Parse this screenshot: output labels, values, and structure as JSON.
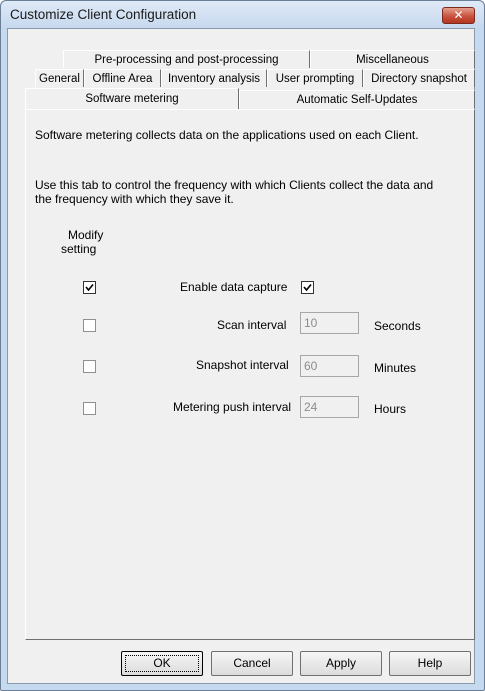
{
  "window": {
    "title": "Customize Client Configuration",
    "close_glyph": "✕"
  },
  "tabs": {
    "row1": [
      "Pre-processing and post-processing",
      "Miscellaneous"
    ],
    "row2": [
      "General",
      "Offline Area",
      "Inventory analysis",
      "User prompting",
      "Directory snapshot"
    ],
    "row3": [
      "Software metering",
      "Automatic Self-Updates"
    ],
    "selected": "Software metering"
  },
  "panel": {
    "description": "Software metering collects data on the applications used on each Client.",
    "instructions_line1": "Use this tab to control the frequency with which Clients collect the data and",
    "instructions_line2": "the frequency with which they save it.",
    "modify_header_line1": "Modify",
    "modify_header_line2": "setting",
    "rows": {
      "enable": {
        "label": "Enable data capture",
        "modify_checked": true,
        "value_checked": true
      },
      "scan": {
        "label": "Scan interval",
        "value": "10",
        "unit": "Seconds",
        "modify_checked": false
      },
      "snapshot": {
        "label": "Snapshot interval",
        "value": "60",
        "unit": "Minutes",
        "modify_checked": false
      },
      "push": {
        "label": "Metering push interval",
        "value": "24",
        "unit": "Hours",
        "modify_checked": false
      }
    }
  },
  "buttons": {
    "ok": "OK",
    "cancel": "Cancel",
    "apply": "Apply",
    "help": "Help"
  }
}
